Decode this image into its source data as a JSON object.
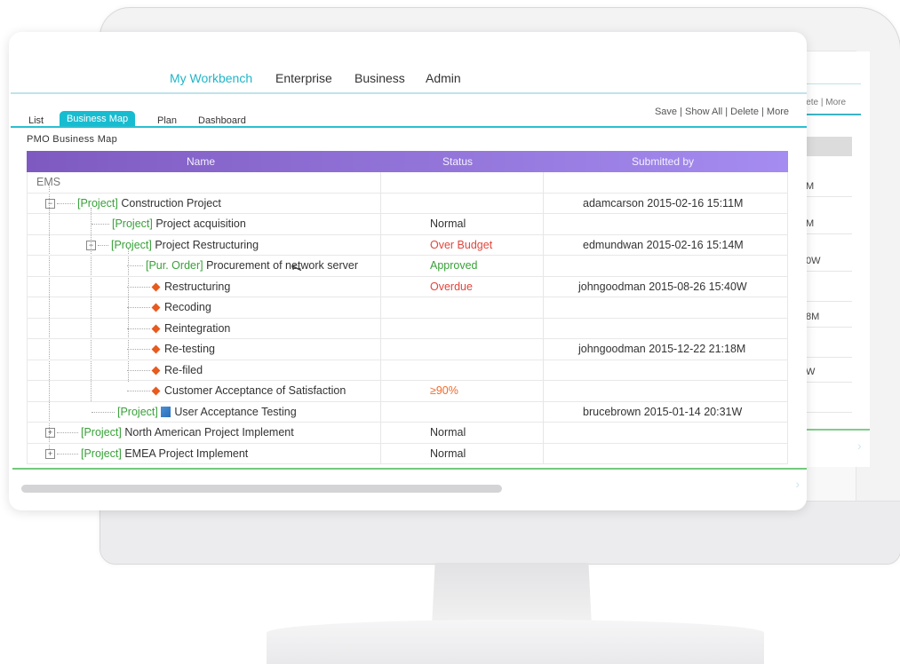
{
  "topnav": {
    "items": [
      "My Workbench",
      "Enterprise",
      "Business",
      "Admin"
    ],
    "active": "My Workbench"
  },
  "subtabs": {
    "items": [
      "List",
      "Business Map",
      "Plan",
      "Dashboard"
    ],
    "active": "Business Map"
  },
  "actions": "Save | Show All | Delete | More",
  "section_title": "PMO Business Map",
  "table": {
    "columns": [
      "Name",
      "Status",
      "Submitted by"
    ],
    "rows": [
      {
        "prefix": "",
        "name": "EMS",
        "status": "",
        "submitted": ""
      },
      {
        "prefix": "[Project]",
        "name": "Construction Project",
        "status": "",
        "submitted": "adamcarson 2015-02-16 15:11M"
      },
      {
        "prefix": "[Project]",
        "name": "Project acquisition",
        "status": "Normal",
        "submitted": ""
      },
      {
        "prefix": "[Project]",
        "name": "Project Restructuring",
        "status": "Over Budget",
        "submitted": "edmundwan 2015-02-16 15:14M"
      },
      {
        "prefix": "[Pur. Order]",
        "name": "Procurement of network server",
        "status": "Approved",
        "submitted": ""
      },
      {
        "prefix": "",
        "name": "Restructuring",
        "status": "Overdue",
        "submitted": "johngoodman 2015-08-26 15:40W"
      },
      {
        "prefix": "",
        "name": "Recoding",
        "status": "",
        "submitted": ""
      },
      {
        "prefix": "",
        "name": "Reintegration",
        "status": "",
        "submitted": ""
      },
      {
        "prefix": "",
        "name": "Re-testing",
        "status": "",
        "submitted": "johngoodman 2015-12-22 21:18M"
      },
      {
        "prefix": "",
        "name": "Re-filed",
        "status": "",
        "submitted": ""
      },
      {
        "prefix": "",
        "name": "Customer Acceptance of Satisfaction",
        "status": "≥90%",
        "submitted": ""
      },
      {
        "prefix": "[Project]",
        "name": "User Acceptance Testing",
        "status": "",
        "submitted": "brucebrown 2015-01-14 20:31W"
      },
      {
        "prefix": "[Project]",
        "name": "North American Project Implement",
        "status": "Normal",
        "submitted": ""
      },
      {
        "prefix": "[Project]",
        "name": "EMEA Project Implement",
        "status": "Normal",
        "submitted": ""
      }
    ]
  },
  "back_window": {
    "actions": "lete | More",
    "rows": [
      "M",
      "M",
      "0W",
      "",
      "8M",
      "",
      "W",
      ""
    ]
  },
  "colors": {
    "accent": "#1fb6c8",
    "header_gradient_start": "#7e5ac0",
    "header_gradient_end": "#a58cf0",
    "project_green": "#39a13a",
    "alert_red": "#e2453c",
    "diamond_orange": "#e85a1e"
  },
  "icons": {
    "tree_expand": "minus-box-icon",
    "tree_collapse": "plus-box-icon",
    "task": "diamond-icon",
    "document": "document-icon",
    "cursor": "mouse-pointer-icon"
  }
}
